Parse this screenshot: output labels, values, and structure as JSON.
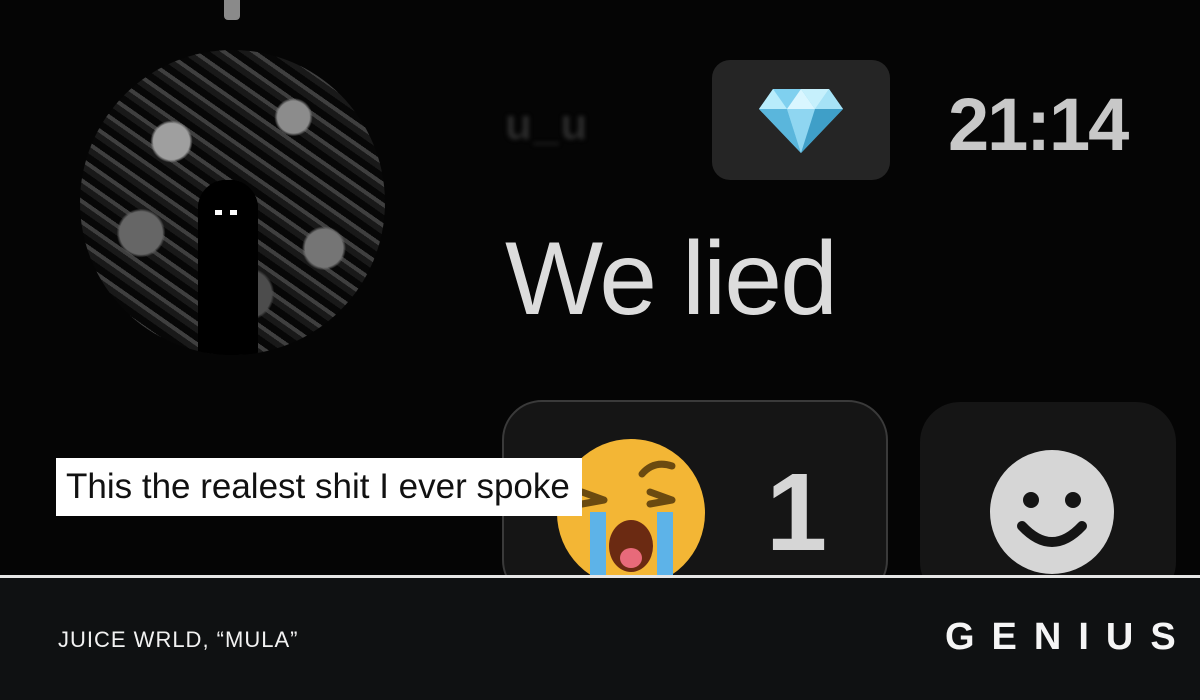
{
  "chat": {
    "username": "u_u",
    "badge_icon": "gem-icon",
    "timestamp": "21:14",
    "message": "We lied",
    "reaction": {
      "icon": "loudly-crying-face-icon",
      "count": "1"
    },
    "add_reaction_icon": "smiley-face-icon"
  },
  "caption": "This the realest shit I ever spoke",
  "footer": {
    "credit": "JUICE WRLD, “MULA”",
    "logo": "GENIUS"
  },
  "colors": {
    "background": "#050505",
    "badge_bg": "#252525",
    "footer_bg": "#0f1112",
    "emoji_yellow": "#f3b635",
    "tear_blue": "#5db3e8"
  }
}
